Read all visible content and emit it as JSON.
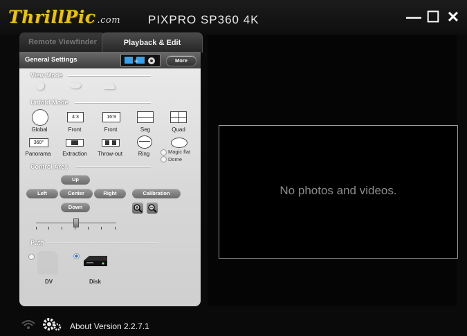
{
  "app": {
    "logo_main": "ThrillPic",
    "logo_suffix": ".com",
    "product": "PIXPRO SP360 4K",
    "window_controls": {
      "minimize": "—",
      "maximize": "☐",
      "close": "✕"
    }
  },
  "tabs": [
    {
      "label": "Remote Viewfinder",
      "active": false
    },
    {
      "label": "Playback & Edit",
      "active": true
    }
  ],
  "panel": {
    "title": "General Settings",
    "more_label": "More",
    "sections": {
      "view_mode": "View Mode",
      "unfold_mode": "Unfold Mode",
      "control_area": "Control Area",
      "path": "Path"
    },
    "unfold_row1": [
      {
        "label": "Global",
        "icon": "circle-icon"
      },
      {
        "label": "Front",
        "icon": "4:3"
      },
      {
        "label": "Front",
        "icon": "16:9"
      },
      {
        "label": "Seg",
        "icon": "seg-icon"
      },
      {
        "label": "Quad",
        "icon": "quad-icon"
      }
    ],
    "unfold_row2": [
      {
        "label": "Panorama",
        "icon": "360°"
      },
      {
        "label": "Extraction",
        "icon": "extraction-icon"
      },
      {
        "label": "Throw-out",
        "icon": "throw-out-icon"
      },
      {
        "label": "Ring",
        "icon": "ring-icon"
      }
    ],
    "magic_options": [
      "Magic flat",
      "Dome"
    ],
    "controls": {
      "up": "Up",
      "left": "Left",
      "center": "Center",
      "right": "Right",
      "down": "Down",
      "calibration": "Calibration"
    },
    "path_options": [
      {
        "label": "DV",
        "selected": false
      },
      {
        "label": "Disk",
        "selected": true
      }
    ]
  },
  "viewer": {
    "message": "No photos and videos."
  },
  "footer": {
    "about": "About Version 2.2.7.1"
  },
  "colors": {
    "accent": "#e8c21a",
    "panel": "#e2e2e2",
    "background": "#0a0a0a"
  }
}
